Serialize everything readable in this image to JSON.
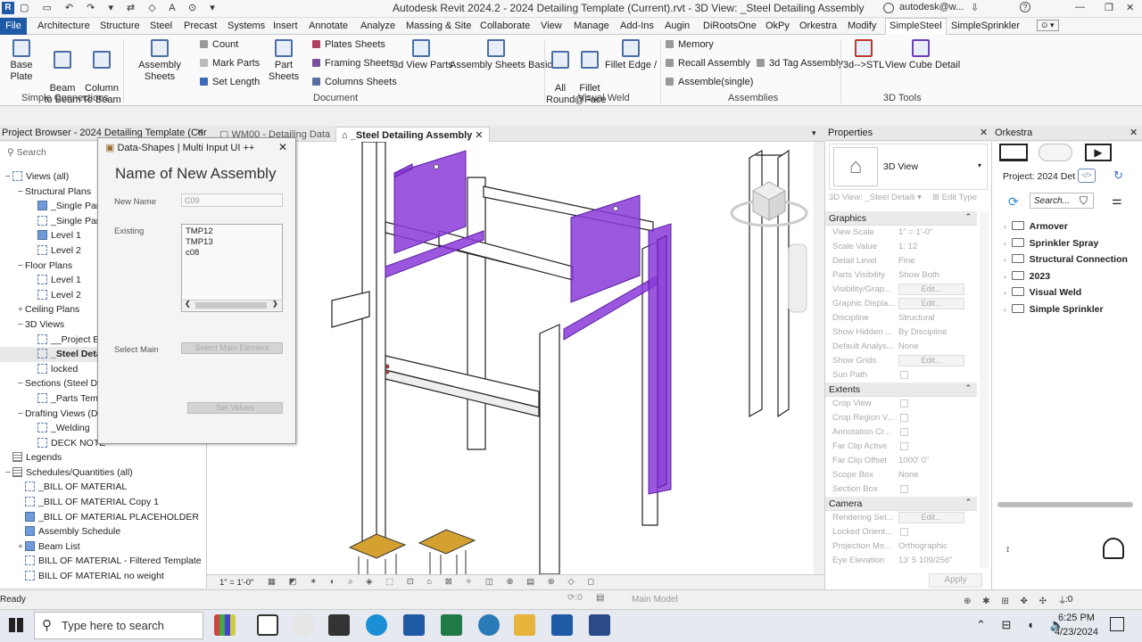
{
  "window": {
    "title": "Autodesk Revit 2024.2 - 2024 Detailing Template (Current).rvt - 3D View: _Steel Detailing Assembly",
    "user": "autodesk@w...",
    "help": "?"
  },
  "menu": {
    "file": "File",
    "tabs": [
      "Architecture",
      "Structure",
      "Steel",
      "Precast",
      "Systems",
      "Insert",
      "Annotate",
      "Analyze",
      "Massing & Site",
      "Collaborate",
      "View",
      "Manage",
      "Add-Ins",
      "Augin",
      "DiRootsOne",
      "OkPy",
      "Orkestra",
      "Modify",
      "SimpleSteel",
      "SimpleSprinkler"
    ],
    "active": "SimpleSteel"
  },
  "ribbon": {
    "simple_connections": {
      "group": "Simple Connections",
      "buttons": [
        "Base Plate",
        "Beam\nto Beam",
        "Column\nTo Beam"
      ]
    },
    "assembly_sheets": "Assembly Sheets",
    "document_small_1": [
      "Count",
      "Mark Parts",
      "Set Length"
    ],
    "part_sheets": "Part Sheets",
    "document_small_2": [
      "Plates Sheets",
      "Framing Sheets",
      "Columns Sheets"
    ],
    "view_3d_parts": "3d View Parts",
    "assembly_sheets_basic": "Assembly Sheets Basic",
    "document_group": "Document",
    "visual_weld": {
      "group": "Visual Weld",
      "buttons": [
        "All\nRound",
        "Fillet\n@Face",
        "Fillet Edge /"
      ]
    },
    "assemblies": {
      "group": "Assemblies",
      "small": [
        "Memory",
        "Recall Assembly",
        "Assemble(single)"
      ],
      "tag": "3d Tag Assembly"
    },
    "tools_3d": {
      "group": "3D Tools",
      "buttons": [
        "3d-->STL",
        "View Cube Detail"
      ]
    }
  },
  "project_browser": {
    "title": "Project Browser - 2024 Detailing Template (Curr...",
    "search_placeholder": "Search",
    "items": [
      {
        "label": "Views (all)",
        "level": 0,
        "exp": "−",
        "icon": "views"
      },
      {
        "label": "Structural Plans",
        "level": 1,
        "exp": "−",
        "icon": ""
      },
      {
        "label": "_Single Part",
        "level": 2,
        "exp": "",
        "icon": "solid"
      },
      {
        "label": "_Single Part",
        "level": 2,
        "exp": "",
        "icon": "dash"
      },
      {
        "label": "Level 1",
        "level": 2,
        "exp": "",
        "icon": "solid"
      },
      {
        "label": "Level 2",
        "level": 2,
        "exp": "",
        "icon": "dash"
      },
      {
        "label": "Floor Plans",
        "level": 1,
        "exp": "−",
        "icon": ""
      },
      {
        "label": "Level 1",
        "level": 2,
        "exp": "",
        "icon": "dash"
      },
      {
        "label": "Level 2",
        "level": 2,
        "exp": "",
        "icon": "dash"
      },
      {
        "label": "Ceiling Plans",
        "level": 1,
        "exp": "+",
        "icon": ""
      },
      {
        "label": "3D Views",
        "level": 1,
        "exp": "−",
        "icon": ""
      },
      {
        "label": "__Project Ba",
        "level": 2,
        "exp": "",
        "icon": "dash"
      },
      {
        "label": "_Steel Deta",
        "level": 2,
        "exp": "",
        "icon": "dash",
        "bold": true
      },
      {
        "label": "locked",
        "level": 2,
        "exp": "",
        "icon": "dash"
      },
      {
        "label": "Sections (Steel De",
        "level": 1,
        "exp": "−",
        "icon": ""
      },
      {
        "label": "_Parts Temp",
        "level": 2,
        "exp": "",
        "icon": "dash"
      },
      {
        "label": "Drafting Views (De",
        "level": 1,
        "exp": "−",
        "icon": ""
      },
      {
        "label": "_Welding",
        "level": 2,
        "exp": "",
        "icon": "dash"
      },
      {
        "label": "DECK NOTE",
        "level": 2,
        "exp": "",
        "icon": "dash"
      },
      {
        "label": "Legends",
        "level": 0,
        "exp": "",
        "icon": "tbl"
      },
      {
        "label": "Schedules/Quantities (all)",
        "level": 0,
        "exp": "−",
        "icon": "tbl"
      },
      {
        "label": "_BILL OF MATERIAL",
        "level": 1,
        "exp": "",
        "icon": "dash"
      },
      {
        "label": "_BILL OF MATERIAL Copy 1",
        "level": 1,
        "exp": "",
        "icon": "dash"
      },
      {
        "label": "_BILL OF MATERIAL PLACEHOLDER",
        "level": 1,
        "exp": "",
        "icon": "solid"
      },
      {
        "label": "Assembly Schedule",
        "level": 1,
        "exp": "",
        "icon": "solid"
      },
      {
        "label": "Beam List",
        "level": 1,
        "exp": "+",
        "icon": "solid"
      },
      {
        "label": "BILL OF MATERIAL - Filtered Template",
        "level": 1,
        "exp": "",
        "icon": "dash"
      },
      {
        "label": "BILL OF MATERIAL no weight",
        "level": 1,
        "exp": "",
        "icon": "dash"
      }
    ]
  },
  "dialog": {
    "caption": "Data-Shapes | Multi Input UI ++",
    "heading": "Name of New Assembly",
    "new_name_label": "New Name",
    "new_name_value": "C09",
    "existing_label": "Existing",
    "existing_items": [
      "TMP12",
      "TMP13",
      "c08"
    ],
    "select_main_label": "Select Main",
    "select_main_button": "Select Main Element",
    "ok_button": "Set Values"
  },
  "view_tabs": [
    {
      "label": "WM00 - Detailing Data",
      "active": false
    },
    {
      "label": "_Steel Detailing Assembly",
      "active": true
    }
  ],
  "view_status": {
    "scale": "1\" = 1'-0\""
  },
  "properties": {
    "title": "Properties",
    "type": "3D View",
    "instance": "3D View: _Steel Detaili",
    "edit_type": "Edit Type",
    "sections": [
      {
        "name": "Graphics",
        "rows": [
          {
            "k": "View Scale",
            "v": "1\" = 1'-0\""
          },
          {
            "k": "Scale Value",
            "v": "1:  12"
          },
          {
            "k": "Detail Level",
            "v": "Fine"
          },
          {
            "k": "Parts Visibility",
            "v": "Show Both"
          },
          {
            "k": "Visibility/Grap...",
            "v": "Edit..."
          },
          {
            "k": "Graphic Displa...",
            "v": "Edit..."
          },
          {
            "k": "Discipline",
            "v": "Structural"
          },
          {
            "k": "Show Hidden ...",
            "v": "By Discipline"
          },
          {
            "k": "Default Analys...",
            "v": "None"
          },
          {
            "k": "Show Grids",
            "v": "Edit..."
          },
          {
            "k": "Sun Path",
            "v": "[]"
          }
        ]
      },
      {
        "name": "Extents",
        "rows": [
          {
            "k": "Crop View",
            "v": "[]"
          },
          {
            "k": "Crop Region V...",
            "v": "[]"
          },
          {
            "k": "Annotation Cr...",
            "v": "[]"
          },
          {
            "k": "Far Clip Active",
            "v": "[]"
          },
          {
            "k": "Far Clip Offset",
            "v": "1000'  0\""
          },
          {
            "k": "Scope Box",
            "v": "None"
          },
          {
            "k": "Section Box",
            "v": "[]"
          }
        ]
      },
      {
        "name": "Camera",
        "rows": [
          {
            "k": "Rendering Set...",
            "v": "Edit..."
          },
          {
            "k": "Locked Orient...",
            "v": "[]"
          },
          {
            "k": "Projection Mo...",
            "v": "Orthographic"
          },
          {
            "k": "Eye Elevation",
            "v": "13'  5 109/256\""
          }
        ]
      }
    ],
    "apply": "Apply"
  },
  "orkestra": {
    "title": "Orkestra",
    "project": "Project: 2024 Det",
    "search_placeholder": "Search...",
    "folders": [
      "Armover",
      "Sprinkler Spray",
      "Structural Connection",
      "2023",
      "Visual Weld",
      "Simple Sprinkler"
    ]
  },
  "status": {
    "ready": "Ready",
    "model": "Main Model",
    "zero1": ":0",
    "zero2": ":0"
  },
  "taskbar": {
    "search_placeholder": "Type here to search",
    "time": "6:25 PM",
    "date": "4/23/2024"
  },
  "colors": {
    "accent": "#1f5aa6",
    "steel_purple": "#8a3bd9"
  }
}
